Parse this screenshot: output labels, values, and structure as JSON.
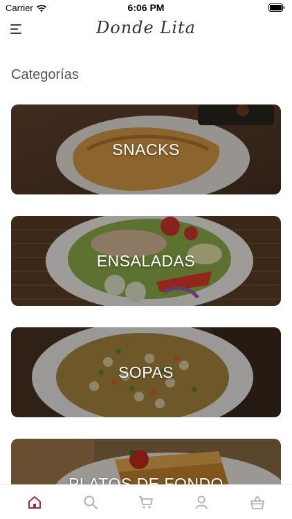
{
  "status_bar": {
    "carrier": "Carrier",
    "time": "6:06 PM"
  },
  "header": {
    "logo_text": "Donde Lita"
  },
  "section": {
    "title": "Categorías"
  },
  "categories": [
    {
      "label": "SNACKS"
    },
    {
      "label": "ENSALADAS"
    },
    {
      "label": "SOPAS"
    },
    {
      "label": "PLATOS DE FONDO"
    }
  ],
  "tabs": [
    {
      "name": "home-icon",
      "active": true
    },
    {
      "name": "search-icon",
      "active": false
    },
    {
      "name": "cart-icon",
      "active": false
    },
    {
      "name": "user-icon",
      "active": false
    },
    {
      "name": "basket-icon",
      "active": false
    }
  ],
  "colors": {
    "accent": "#9b2d4a",
    "inactive_icon": "#b0b0b0"
  }
}
